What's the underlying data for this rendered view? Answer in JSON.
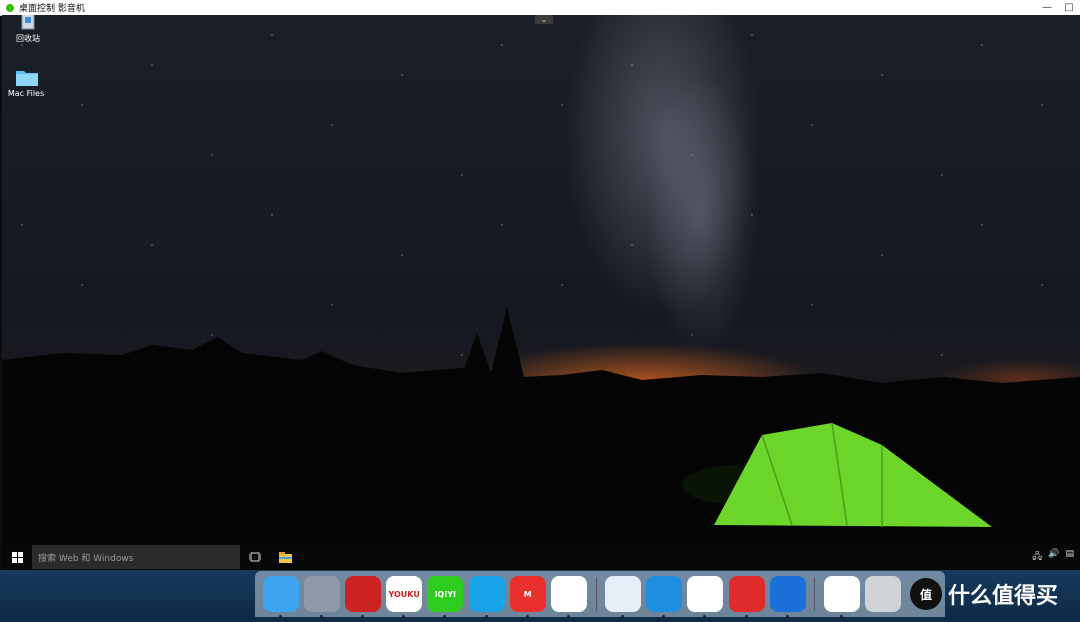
{
  "window": {
    "title": "桌面控制 影音机",
    "controls": [
      "—",
      "□"
    ]
  },
  "desktop": {
    "icons": [
      {
        "label": "回收站",
        "icon": "recycle-bin-icon"
      },
      {
        "label": "Mac Files",
        "icon": "folder-icon"
      }
    ],
    "collapse_glyph": "⌄"
  },
  "taskbar": {
    "search_placeholder": "搜索 Web 和 Windows",
    "tray_icons": [
      "network-icon",
      "volume-icon",
      "notification-icon"
    ]
  },
  "dock": {
    "apps": [
      {
        "name": "finder-app",
        "icon": "finder-icon",
        "color": "#3ea3f0",
        "label": ""
      },
      {
        "name": "launchpad-app",
        "icon": "rocket-icon",
        "color": "#8e9aa8",
        "label": ""
      },
      {
        "name": "parallels-app",
        "icon": "parallels-icon",
        "color": "#c22",
        "label": ""
      },
      {
        "name": "youku-app",
        "icon": "youku-icon",
        "color": "#ffffff",
        "label": "YOUKU"
      },
      {
        "name": "iqiyi-app",
        "icon": "iqiyi-icon",
        "color": "#2ecc1e",
        "label": "iQIYI"
      },
      {
        "name": "tencent-video-app",
        "icon": "play-icon",
        "color": "#1aa3e6",
        "label": ""
      },
      {
        "name": "mgtv-app",
        "icon": "mgtv-icon",
        "color": "#e8302c",
        "label": "M"
      },
      {
        "name": "chrome-app",
        "icon": "chrome-icon",
        "color": "#ffffff",
        "label": ""
      },
      {
        "name": "feishu-app",
        "icon": "bird-icon",
        "color": "#e8eef8",
        "label": ""
      },
      {
        "name": "safari-app",
        "icon": "compass-icon",
        "color": "#1e8fe0",
        "label": ""
      },
      {
        "name": "baidu-netdisk-app",
        "icon": "cloud-icon",
        "color": "#ffffff",
        "label": ""
      },
      {
        "name": "wps-app",
        "icon": "wps-icon",
        "color": "#e12a2a",
        "label": ""
      },
      {
        "name": "windows-app",
        "icon": "windows-icon",
        "color": "#1b6fd8",
        "label": ""
      },
      {
        "name": "document-app",
        "icon": "document-icon",
        "color": "#ffffff",
        "label": ""
      },
      {
        "name": "trash-app",
        "icon": "trash-icon",
        "color": "#d0d4d8",
        "label": ""
      }
    ]
  },
  "watermark": {
    "logo_text": "值",
    "text": "什么值得买"
  }
}
